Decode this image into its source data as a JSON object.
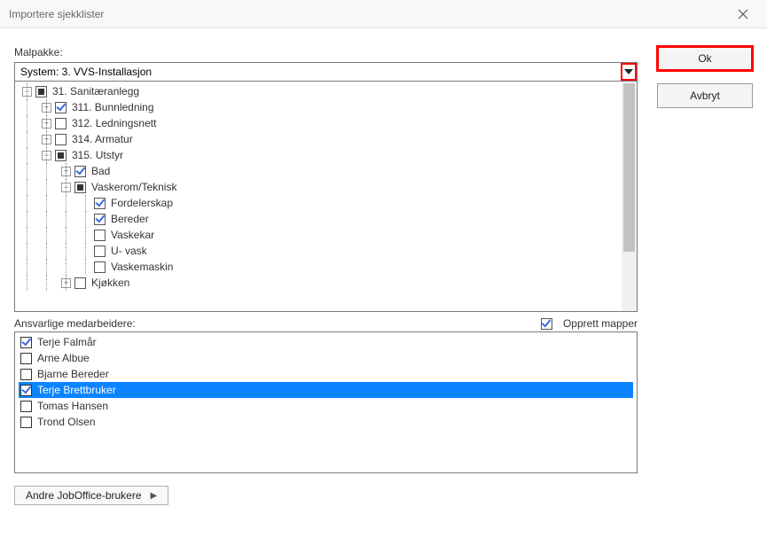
{
  "window": {
    "title": "Importere sjekklister"
  },
  "labels": {
    "malpakke": "Malpakke:",
    "ansvarlige": "Ansvarlige medarbeidere:",
    "opprett_mapper": "Opprett mapper",
    "andre_brukere": "Andre JobOffice-brukere"
  },
  "combo": {
    "value": "System: 3. VVS-Installasjon"
  },
  "buttons": {
    "ok": "Ok",
    "avbryt": "Avbryt"
  },
  "tree": [
    {
      "level": 0,
      "exp": "minus",
      "chk": "mixed",
      "label": "31. Sanitæranlegg"
    },
    {
      "level": 1,
      "exp": "plus",
      "chk": "checked",
      "label": "311. Bunnledning"
    },
    {
      "level": 1,
      "exp": "plus",
      "chk": "unchecked",
      "label": "312. Ledningsnett"
    },
    {
      "level": 1,
      "exp": "plus",
      "chk": "unchecked",
      "label": "314. Armatur"
    },
    {
      "level": 1,
      "exp": "minus",
      "chk": "mixed",
      "label": "315. Utstyr"
    },
    {
      "level": 2,
      "exp": "plus",
      "chk": "checked",
      "label": "Bad"
    },
    {
      "level": 2,
      "exp": "minus",
      "chk": "mixed",
      "label": "Vaskerom/Teknisk"
    },
    {
      "level": 3,
      "exp": "",
      "chk": "checked",
      "label": "Fordelerskap"
    },
    {
      "level": 3,
      "exp": "",
      "chk": "checked",
      "label": "Bereder"
    },
    {
      "level": 3,
      "exp": "",
      "chk": "unchecked",
      "label": "Vaskekar"
    },
    {
      "level": 3,
      "exp": "",
      "chk": "unchecked",
      "label": "U- vask"
    },
    {
      "level": 3,
      "exp": "",
      "chk": "unchecked",
      "label": "Vaskemaskin"
    },
    {
      "level": 2,
      "exp": "plus",
      "chk": "unchecked",
      "label": "Kjøkken"
    }
  ],
  "opprett_mapper_checked": true,
  "employees": [
    {
      "name": "Terje Falmår",
      "checked": true,
      "selected": false
    },
    {
      "name": "Arne Albue",
      "checked": false,
      "selected": false
    },
    {
      "name": "Bjarne Bereder",
      "checked": false,
      "selected": false
    },
    {
      "name": "Terje Brettbruker",
      "checked": true,
      "selected": true
    },
    {
      "name": "Tomas Hansen",
      "checked": false,
      "selected": false
    },
    {
      "name": "Trond Olsen",
      "checked": false,
      "selected": false
    }
  ]
}
